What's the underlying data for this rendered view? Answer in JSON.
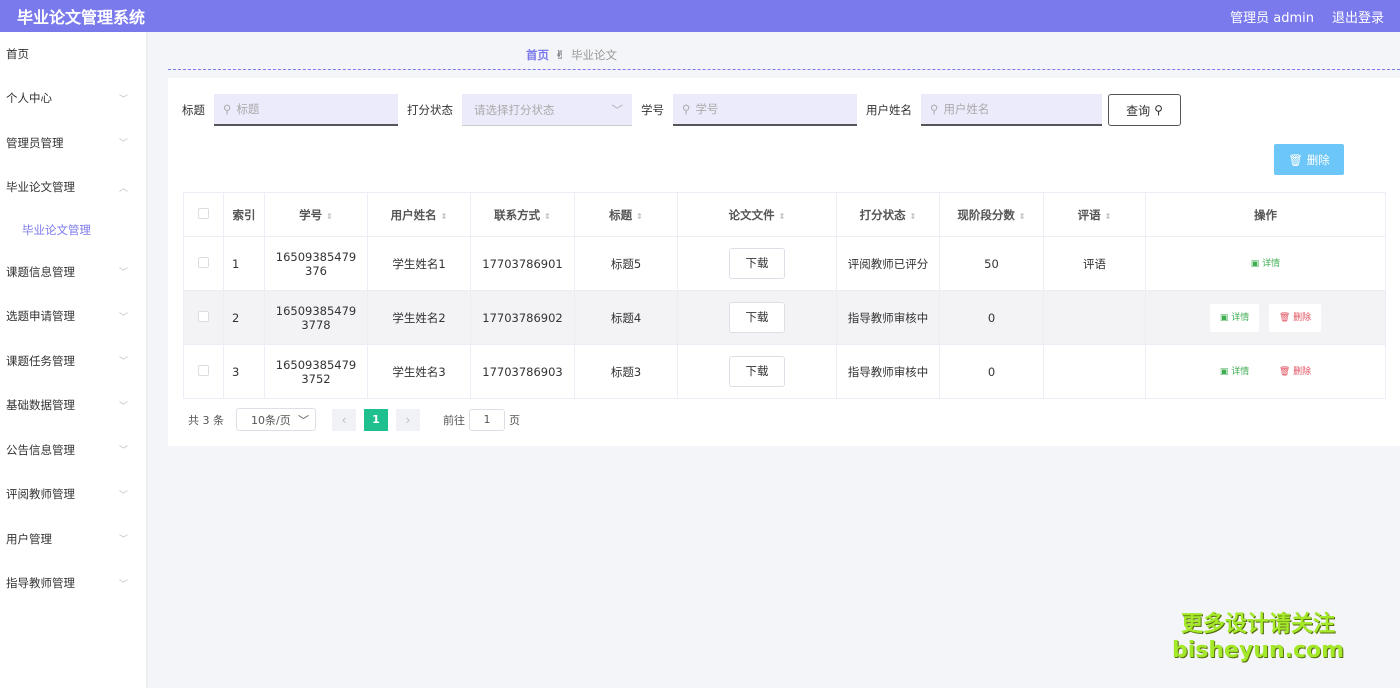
{
  "header": {
    "title": "毕业论文管理系统",
    "user": "管理员 admin",
    "logout": "退出登录"
  },
  "sidebar": {
    "home": "首页",
    "items": [
      {
        "label": "个人中心"
      },
      {
        "label": "管理员管理"
      },
      {
        "label": "毕业论文管理",
        "expanded": true,
        "sub": "毕业论文管理"
      },
      {
        "label": "课题信息管理"
      },
      {
        "label": "选题申请管理"
      },
      {
        "label": "课题任务管理"
      },
      {
        "label": "基础数据管理"
      },
      {
        "label": "公告信息管理"
      },
      {
        "label": "评阅教师管理"
      },
      {
        "label": "用户管理"
      },
      {
        "label": "指导教师管理"
      }
    ]
  },
  "breadcrumb": {
    "home": "首页",
    "separator": "✌",
    "current": "毕业论文"
  },
  "search": {
    "title_label": "标题",
    "title_placeholder": "标题",
    "status_label": "打分状态",
    "status_placeholder": "请选择打分状态",
    "sid_label": "学号",
    "sid_placeholder": "学号",
    "name_label": "用户姓名",
    "name_placeholder": "用户姓名",
    "query_button": "查询"
  },
  "actions": {
    "delete_button": "删除"
  },
  "table": {
    "headers": [
      "索引",
      "学号",
      "用户姓名",
      "联系方式",
      "标题",
      "论文文件",
      "打分状态",
      "现阶段分数",
      "评语",
      "操作"
    ],
    "rows": [
      {
        "idx": "1",
        "sid": "16509385479376",
        "name": "学生姓名1",
        "phone": "17703786901",
        "title": "标题5",
        "file": "下载",
        "status": "评阅教师已评分",
        "score": "50",
        "comment": "评语",
        "detail": "详情",
        "del": ""
      },
      {
        "idx": "2",
        "sid": "165093854793778",
        "name": "学生姓名2",
        "phone": "17703786902",
        "title": "标题4",
        "file": "下载",
        "status": "指导教师审核中",
        "score": "0",
        "comment": "",
        "detail": "详情",
        "del": "删除"
      },
      {
        "idx": "3",
        "sid": "165093854793752",
        "name": "学生姓名3",
        "phone": "17703786903",
        "title": "标题3",
        "file": "下载",
        "status": "指导教师审核中",
        "score": "0",
        "comment": "",
        "detail": "详情",
        "del": "删除"
      }
    ]
  },
  "pagination": {
    "total": "共 3 条",
    "page_size": "10条/页",
    "current": "1",
    "goto_label": "前往",
    "goto_value": "1",
    "page_unit": "页"
  },
  "watermark": {
    "line1": "更多设计请关注",
    "line2": "bisheyun.com"
  },
  "colors": {
    "accent": "#7b7aed",
    "delete_button": "#6cc6f7",
    "page_active": "#1fbf8f"
  }
}
